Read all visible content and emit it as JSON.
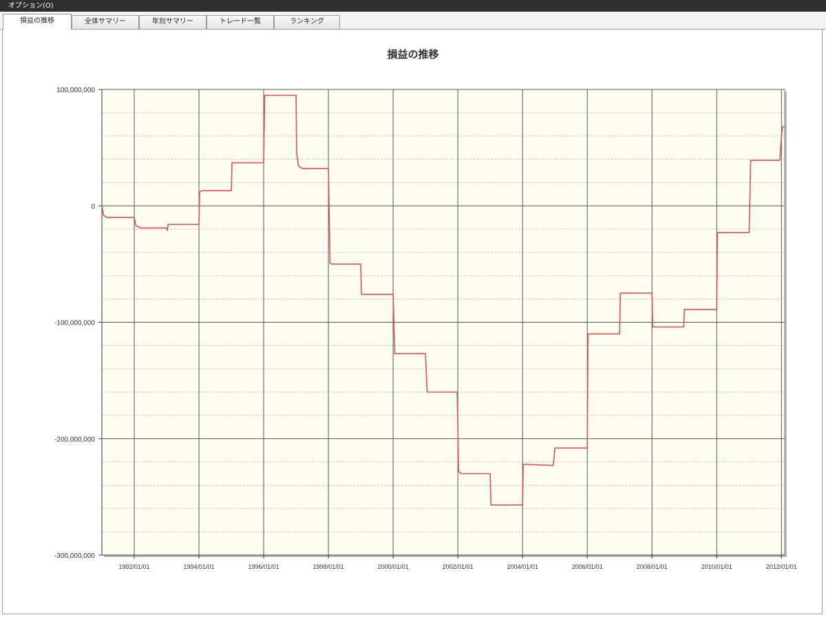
{
  "menu": {
    "title": "オプション(O)"
  },
  "tabs": [
    {
      "label": "損益の推移",
      "active": true
    },
    {
      "label": "全体サマリー",
      "active": false
    },
    {
      "label": "年別サマリー",
      "active": false
    },
    {
      "label": "トレード一覧",
      "active": false
    },
    {
      "label": "ランキング",
      "active": false
    }
  ],
  "colors": {
    "line": "#d9534f",
    "plot_bg": "#fdfdf0",
    "grid_major": "#555555",
    "grid_minor": "#c8c8c8"
  },
  "chart_data": {
    "type": "line",
    "title": "損益の推移",
    "xlabel": "",
    "ylabel": "",
    "ylim": [
      -300000000,
      100000000
    ],
    "xlim": [
      1991.0,
      2012.1
    ],
    "grid": true,
    "yticks": [
      {
        "value": 100000000,
        "label": "100,000,000"
      },
      {
        "value": 0,
        "label": "0"
      },
      {
        "value": -100000000,
        "label": "-100,000,000"
      },
      {
        "value": -200000000,
        "label": "-200,000,000"
      },
      {
        "value": -300000000,
        "label": "-300,000,000"
      }
    ],
    "xticks": [
      {
        "value": 1992,
        "label": "1992/01/01"
      },
      {
        "value": 1994,
        "label": "1994/01/01"
      },
      {
        "value": 1996,
        "label": "1996/01/01"
      },
      {
        "value": 1998,
        "label": "1998/01/01"
      },
      {
        "value": 2000,
        "label": "2000/01/01"
      },
      {
        "value": 2002,
        "label": "2002/01/01"
      },
      {
        "value": 2004,
        "label": "2004/01/01"
      },
      {
        "value": 2006,
        "label": "2006/01/01"
      },
      {
        "value": 2008,
        "label": "2008/01/01"
      },
      {
        "value": 2010,
        "label": "2010/01/01"
      },
      {
        "value": 2012,
        "label": "2012/01/01"
      }
    ],
    "series": [
      {
        "points": [
          [
            1991.0,
            0
          ],
          [
            1991.05,
            -8000000
          ],
          [
            1991.15,
            -10000000
          ],
          [
            1992.0,
            -10000000
          ],
          [
            1992.05,
            -17000000
          ],
          [
            1992.2,
            -19000000
          ],
          [
            1993.0,
            -19000000
          ],
          [
            1993.02,
            -21000000
          ],
          [
            1993.05,
            -16000000
          ],
          [
            1994.0,
            -16000000
          ],
          [
            1994.02,
            12000000
          ],
          [
            1994.1,
            13000000
          ],
          [
            1995.0,
            13000000
          ],
          [
            1995.02,
            37000000
          ],
          [
            1996.0,
            37000000
          ],
          [
            1996.03,
            95000000
          ],
          [
            1997.0,
            95000000
          ],
          [
            1997.02,
            45000000
          ],
          [
            1997.08,
            34000000
          ],
          [
            1997.2,
            32000000
          ],
          [
            1998.0,
            32000000
          ],
          [
            1998.05,
            -49000000
          ],
          [
            1998.1,
            -50000000
          ],
          [
            1999.0,
            -50000000
          ],
          [
            1999.02,
            -76000000
          ],
          [
            2000.0,
            -76000000
          ],
          [
            2000.05,
            -127000000
          ],
          [
            2001.0,
            -127000000
          ],
          [
            2001.05,
            -160000000
          ],
          [
            2001.98,
            -160000000
          ],
          [
            2002.0,
            -190000000
          ],
          [
            2002.02,
            -228000000
          ],
          [
            2002.1,
            -230000000
          ],
          [
            2003.0,
            -230000000
          ],
          [
            2003.02,
            -257000000
          ],
          [
            2004.0,
            -257000000
          ],
          [
            2004.02,
            -222000000
          ],
          [
            2004.95,
            -223000000
          ],
          [
            2005.0,
            -208000000
          ],
          [
            2006.0,
            -208000000
          ],
          [
            2006.02,
            -110000000
          ],
          [
            2007.0,
            -110000000
          ],
          [
            2007.02,
            -75000000
          ],
          [
            2008.0,
            -75000000
          ],
          [
            2008.02,
            -104000000
          ],
          [
            2008.98,
            -104000000
          ],
          [
            2009.0,
            -89000000
          ],
          [
            2010.0,
            -89000000
          ],
          [
            2010.02,
            -23000000
          ],
          [
            2011.0,
            -23000000
          ],
          [
            2011.05,
            39000000
          ],
          [
            2011.95,
            39000000
          ],
          [
            2012.0,
            60000000
          ],
          [
            2012.03,
            68000000
          ],
          [
            2012.1,
            68000000
          ]
        ]
      }
    ]
  }
}
